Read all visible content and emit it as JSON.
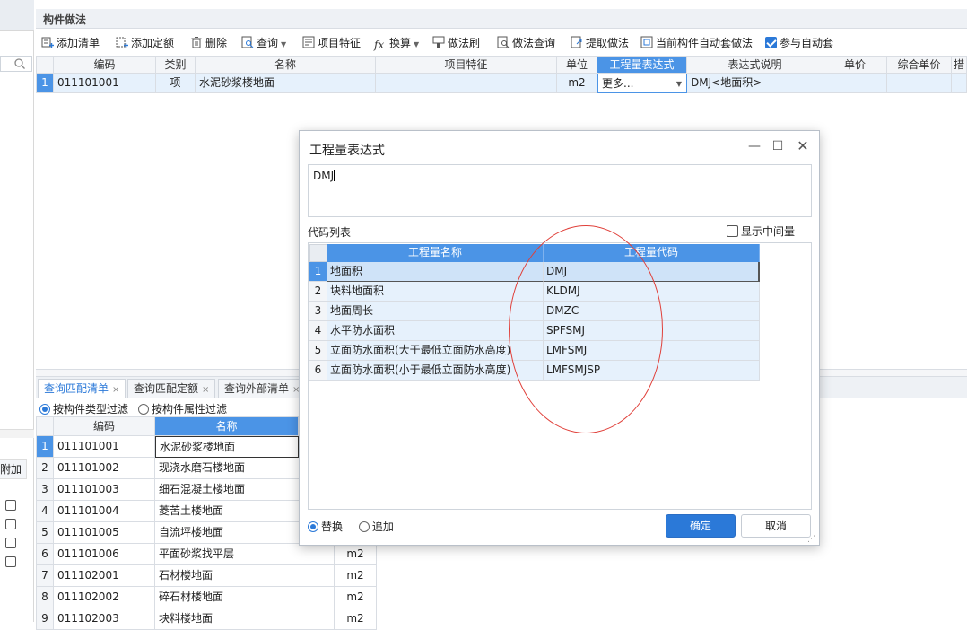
{
  "panel": {
    "title": "构件做法"
  },
  "toolbar": {
    "add_list": "添加清单",
    "add_quota": "添加定额",
    "delete": "删除",
    "query": "查询",
    "item_feature": "项目特征",
    "convert": "换算",
    "method_brush": "做法刷",
    "method_query": "做法查询",
    "extract_method": "提取做法",
    "auto_apply_current": "当前构件自动套做法",
    "join_auto": "参与自动套"
  },
  "main_grid": {
    "headers": [
      "编码",
      "类别",
      "名称",
      "项目特征",
      "单位",
      "工程量表达式",
      "表达式说明",
      "单价",
      "综合单价",
      "措"
    ],
    "row": {
      "num": "1",
      "code": "011101001",
      "type": "项",
      "name": "水泥砂浆楼地面",
      "feature": "",
      "unit": "m2",
      "expr": "更多...",
      "expr_desc": "DMJ<地面积>"
    }
  },
  "bottom_tabs": [
    {
      "label": "查询匹配清单",
      "active": true
    },
    {
      "label": "查询匹配定额",
      "active": false
    },
    {
      "label": "查询外部清单",
      "active": false
    }
  ],
  "filters": {
    "by_type": "按构件类型过滤",
    "by_attr": "按构件属性过滤"
  },
  "left_panel": {
    "column_label": "附加"
  },
  "bottom_grid": {
    "headers": [
      "编码",
      "名称"
    ],
    "rows": [
      {
        "num": "1",
        "code": "011101001",
        "name": "水泥砂浆楼地面",
        "unit": ""
      },
      {
        "num": "2",
        "code": "011101002",
        "name": "现浇水磨石楼地面",
        "unit": ""
      },
      {
        "num": "3",
        "code": "011101003",
        "name": "细石混凝土楼地面",
        "unit": ""
      },
      {
        "num": "4",
        "code": "011101004",
        "name": "菱苦土楼地面",
        "unit": ""
      },
      {
        "num": "5",
        "code": "011101005",
        "name": "自流坪楼地面",
        "unit": ""
      },
      {
        "num": "6",
        "code": "011101006",
        "name": "平面砂浆找平层",
        "unit": "m2"
      },
      {
        "num": "7",
        "code": "011102001",
        "name": "石材楼地面",
        "unit": "m2"
      },
      {
        "num": "8",
        "code": "011102002",
        "name": "碎石材楼地面",
        "unit": "m2"
      },
      {
        "num": "9",
        "code": "011102003",
        "name": "块料楼地面",
        "unit": "m2"
      }
    ]
  },
  "dialog": {
    "title": "工程量表达式",
    "expression": "DMJ",
    "code_list_label": "代码列表",
    "show_intermediate": "显示中间量",
    "headers": [
      "工程量名称",
      "工程量代码"
    ],
    "rows": [
      {
        "num": "1",
        "name": "地面积",
        "code": "DMJ"
      },
      {
        "num": "2",
        "name": "块料地面积",
        "code": "KLDMJ"
      },
      {
        "num": "3",
        "name": "地面周长",
        "code": "DMZC"
      },
      {
        "num": "4",
        "name": "水平防水面积",
        "code": "SPFSMJ"
      },
      {
        "num": "5",
        "name": "立面防水面积(大于最低立面防水高度)",
        "code": "LMFSMJ"
      },
      {
        "num": "6",
        "name": "立面防水面积(小于最低立面防水高度)",
        "code": "LMFSMJSP"
      }
    ],
    "replace": "替换",
    "append": "追加",
    "ok": "确定",
    "cancel": "取消"
  },
  "colors": {
    "accent": "#2b79d8",
    "header_active": "#4b94e6",
    "row_highlight": "#e6f1fc",
    "annotation": "#e0403a"
  }
}
